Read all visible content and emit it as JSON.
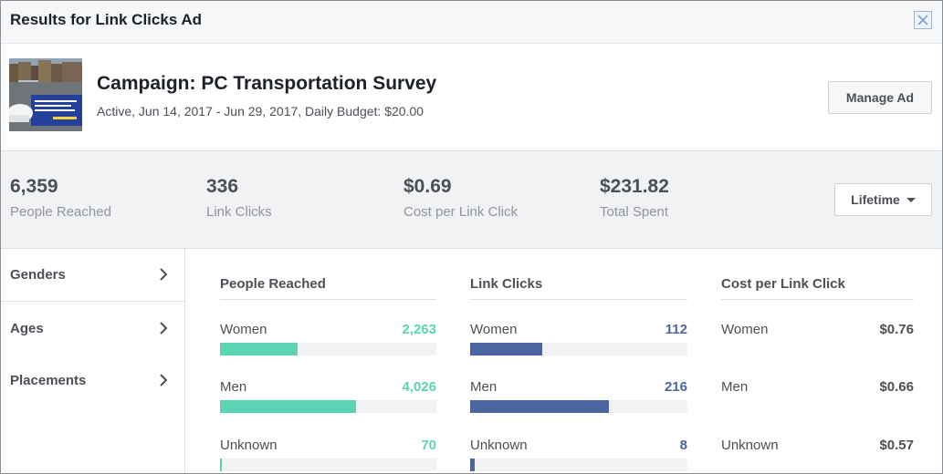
{
  "dialog": {
    "title": "Results for Link Clicks Ad"
  },
  "campaign": {
    "name": "Campaign: PC Transportation Survey",
    "meta": "Active, Jun 14, 2017 - Jun 29, 2017, Daily Budget: $20.00",
    "manage_label": "Manage Ad"
  },
  "stats": [
    {
      "value": "6,359",
      "label": "People Reached"
    },
    {
      "value": "336",
      "label": "Link Clicks"
    },
    {
      "value": "$0.69",
      "label": "Cost per Link Click"
    },
    {
      "value": "$231.82",
      "label": "Total Spent"
    }
  ],
  "timeframe": {
    "label": "Lifetime"
  },
  "sidebar": {
    "items": [
      {
        "label": "Genders"
      },
      {
        "label": "Ages"
      },
      {
        "label": "Placements"
      }
    ]
  },
  "breakdown": {
    "people_reached": {
      "header": "People Reached",
      "color": "#5ad4b2",
      "rows": [
        {
          "name": "Women",
          "value": "2,263",
          "fraction": 0.36
        },
        {
          "name": "Men",
          "value": "4,026",
          "fraction": 0.63
        },
        {
          "name": "Unknown",
          "value": "70",
          "fraction": 0.01
        }
      ]
    },
    "link_clicks": {
      "header": "Link Clicks",
      "color": "#4a65a2",
      "rows": [
        {
          "name": "Women",
          "value": "112",
          "fraction": 0.33
        },
        {
          "name": "Men",
          "value": "216",
          "fraction": 0.64
        },
        {
          "name": "Unknown",
          "value": "8",
          "fraction": 0.02
        }
      ]
    },
    "cost_per_link_click": {
      "header": "Cost per Link Click",
      "color": "#4b4f56",
      "rows": [
        {
          "name": "Women",
          "value": "$0.76"
        },
        {
          "name": "Men",
          "value": "$0.66"
        },
        {
          "name": "Unknown",
          "value": "$0.57"
        }
      ]
    }
  },
  "icons": {
    "close": "close-icon",
    "chevron": "chevron-right-icon",
    "caret": "caret-down-icon"
  }
}
